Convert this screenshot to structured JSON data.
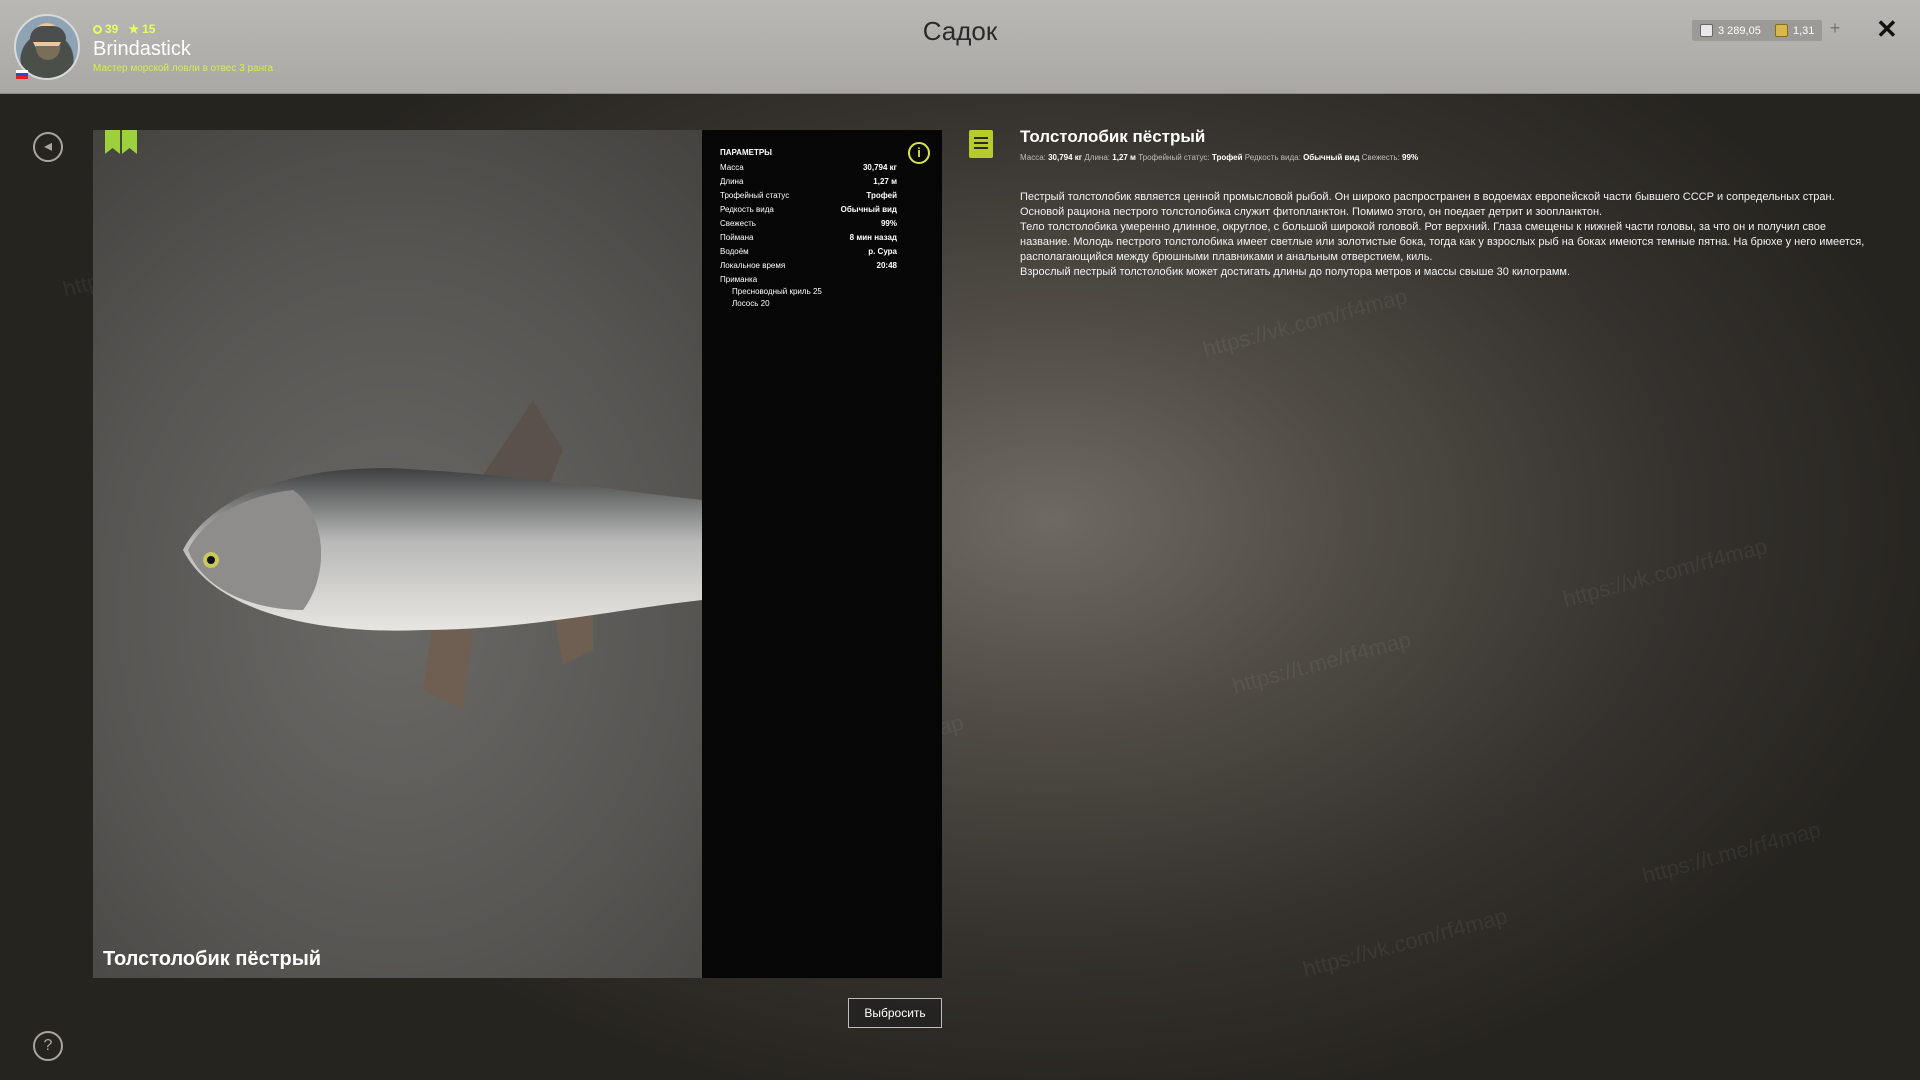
{
  "header": {
    "title": "Садок",
    "player": {
      "level": "39",
      "stars": "15",
      "name": "Brindastick",
      "rank": "Мастер морской ловли в отвес 3 ранга"
    },
    "currency": {
      "silver": "3 289,05",
      "gold": "1,31"
    },
    "plus_label": "+",
    "close_label": "✕"
  },
  "sidebar": {
    "back_label": "◂",
    "help_label": "?"
  },
  "fish_card": {
    "name": "Толстолобик пёстрый"
  },
  "params": {
    "title": "ПАРАМЕТРЫ",
    "info_label": "i",
    "rows": [
      {
        "label": "Масса",
        "value": "30,794 кг"
      },
      {
        "label": "Длина",
        "value": "1,27 м"
      },
      {
        "label": "Трофейный статус",
        "value": "Трофей"
      },
      {
        "label": "Редкость вида",
        "value": "Обычный вид"
      },
      {
        "label": "Свежесть",
        "value": "99%"
      },
      {
        "label": "Поймана",
        "value": "8 мин назад"
      },
      {
        "label": "Водоём",
        "value": "р. Сура"
      },
      {
        "label": "Локальное время",
        "value": "20:48"
      },
      {
        "label": "Приманка",
        "value": ""
      }
    ],
    "baits": [
      "Пресноводный криль 25",
      "Лосось 20"
    ]
  },
  "actions": {
    "throw_label": "Выбросить"
  },
  "description": {
    "title": "Толстолобик пёстрый",
    "meta": {
      "mass_label": "Масса:",
      "mass": "30,794 кг",
      "length_label": "Длина:",
      "length": "1,27 м",
      "trophy_label": "Трофейный статус:",
      "trophy": "Трофей",
      "rarity_label": "Редкость вида:",
      "rarity": "Обычный вид",
      "fresh_label": "Свежесть:",
      "fresh": "99%"
    },
    "lines": [
      "Пестрый толстолобик является ценной промысловой рыбой. Он широко распространен в водоемах европейской части бывшего СССР и сопредельных стран.",
      "Основой рациона пестрого толстолобика служит фитопланктон. Помимо этого, он поедает детрит и зоопланктон.",
      "Тело толстолобика умеренно длинное, округлое, с большой широкой головой. Рот верхний. Глаза смещены к нижней части головы, за что он и получил свое название. Молодь пестрого толстолобика имеет светлые или золотистые бока, тогда как у взрослых рыб на боках имеются темные пятна. На брюхе у него имеется, располагающийся между брюшными плавниками и анальным отверстием, киль.",
      "Взрослый пестрый толстолобик может достигать длины до полутора метров и массы свыше 30 килограмм."
    ]
  },
  "watermarks": [
    "RF4Map",
    "https://vk.com/rf4map",
    "https://t.me/rf4map"
  ],
  "colors": {
    "accent": "#b7cc2c",
    "xp_green": "#e6ff5c"
  }
}
